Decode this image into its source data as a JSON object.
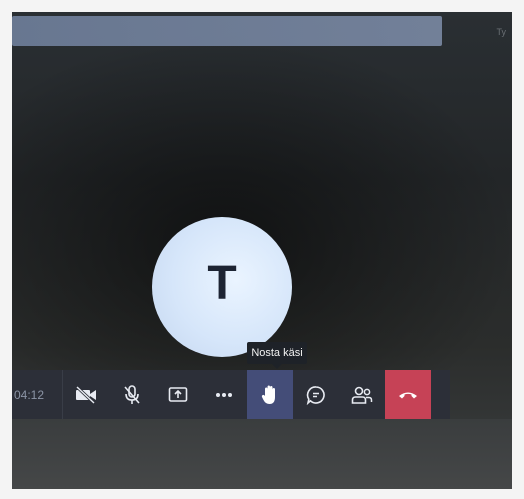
{
  "call": {
    "timer": "04:12",
    "top_right_text": "Ty",
    "avatar_letter": "T"
  },
  "tooltip": {
    "text": "Nosta käsi"
  },
  "toolbar": {
    "buttons": [
      {
        "icon": "camera-off-icon"
      },
      {
        "icon": "mic-off-icon"
      },
      {
        "icon": "share-screen-icon"
      },
      {
        "icon": "more-options-icon"
      },
      {
        "icon": "raise-hand-icon",
        "active": true
      },
      {
        "icon": "chat-icon"
      },
      {
        "icon": "participants-icon"
      },
      {
        "icon": "hang-up-icon"
      }
    ]
  },
  "colors": {
    "toolbar_bg": "#2c2f38",
    "active_button_bg": "#444d78",
    "hangup_bg": "#c64256",
    "avatar_bg": "#d6e6fa"
  }
}
